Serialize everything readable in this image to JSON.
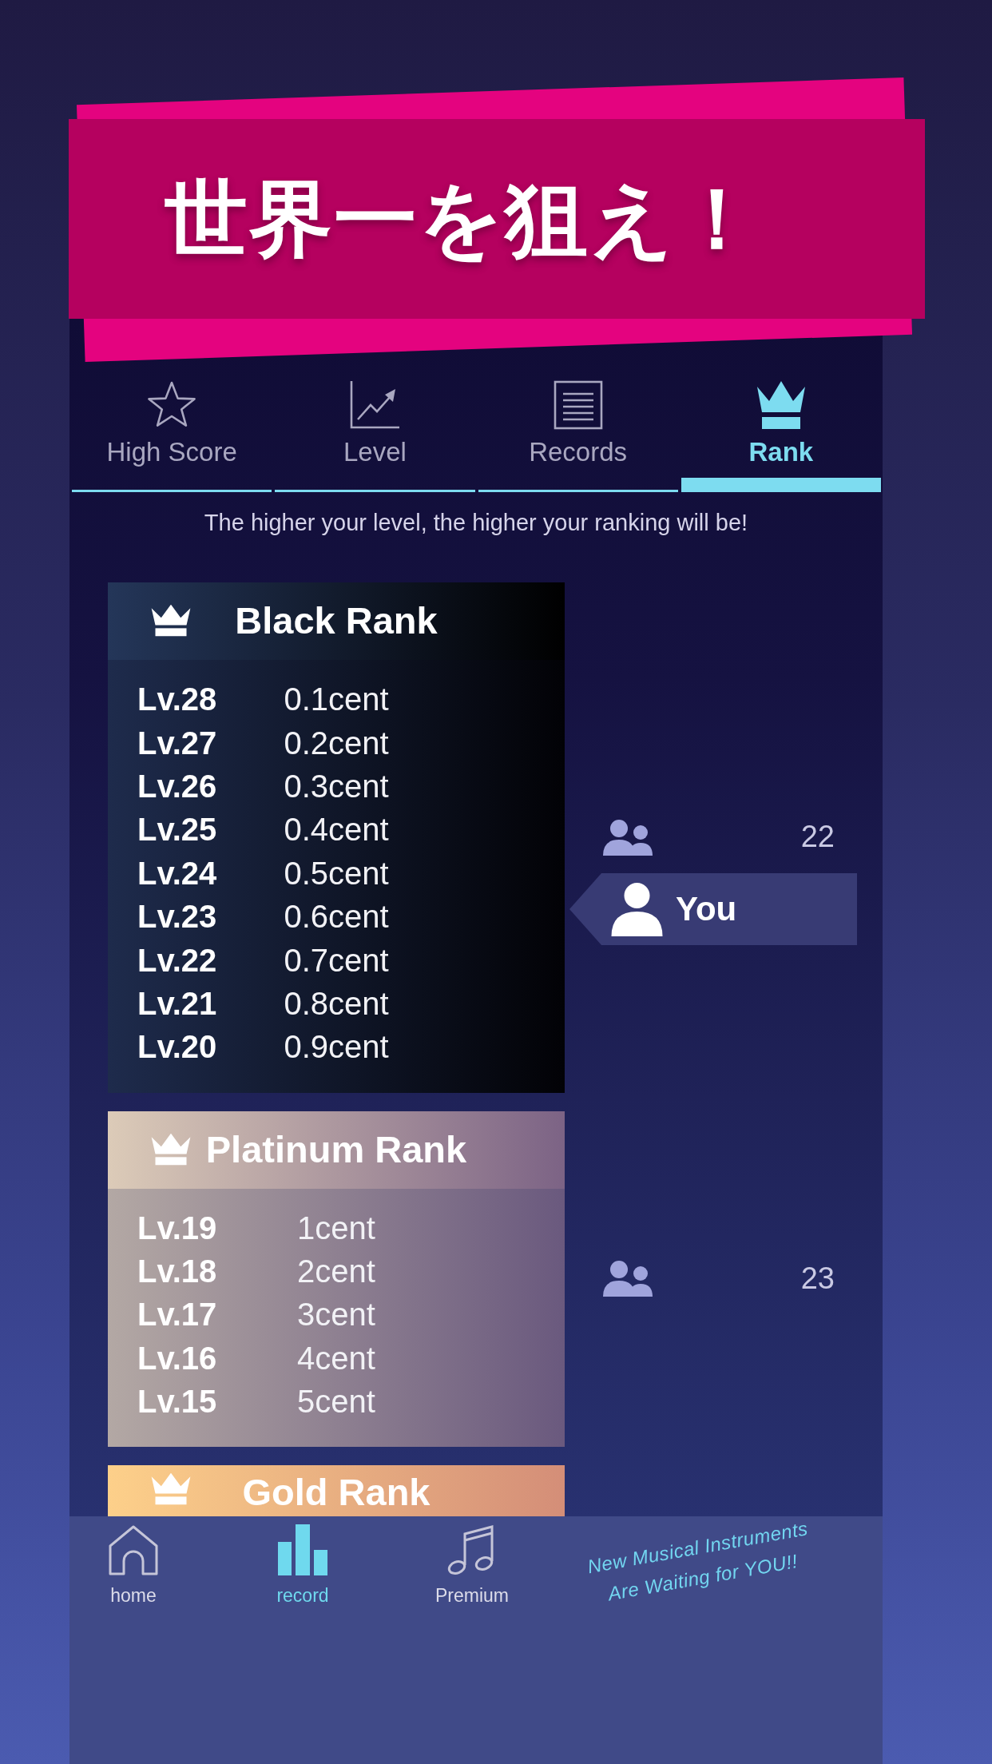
{
  "banner": {
    "title": "世界一を狙え！"
  },
  "tabs": [
    {
      "label": "High Score",
      "selected": false
    },
    {
      "label": "Level",
      "selected": false
    },
    {
      "label": "Records",
      "selected": false
    },
    {
      "label": "Rank",
      "selected": true
    }
  ],
  "hint": "The higher your level, the higher your ranking will be!",
  "ranks": [
    {
      "kind": "black",
      "title": "Black Rank",
      "levels": [
        {
          "level": "Lv.28",
          "reward": "0.1cent"
        },
        {
          "level": "Lv.27",
          "reward": "0.2cent"
        },
        {
          "level": "Lv.26",
          "reward": "0.3cent"
        },
        {
          "level": "Lv.25",
          "reward": "0.4cent"
        },
        {
          "level": "Lv.24",
          "reward": "0.5cent"
        },
        {
          "level": "Lv.23",
          "reward": "0.6cent"
        },
        {
          "level": "Lv.22",
          "reward": "0.7cent"
        },
        {
          "level": "Lv.21",
          "reward": "0.8cent"
        },
        {
          "level": "Lv.20",
          "reward": "0.9cent"
        }
      ],
      "players": "22",
      "you_label": "You"
    },
    {
      "kind": "platinum",
      "title": "Platinum Rank",
      "levels": [
        {
          "level": "Lv.19",
          "reward": "1cent"
        },
        {
          "level": "Lv.18",
          "reward": "2cent"
        },
        {
          "level": "Lv.17",
          "reward": "3cent"
        },
        {
          "level": "Lv.16",
          "reward": "4cent"
        },
        {
          "level": "Lv.15",
          "reward": "5cent"
        }
      ],
      "players": "23"
    },
    {
      "kind": "gold",
      "title": "Gold Rank"
    }
  ],
  "nav": [
    {
      "label": "home",
      "selected": false
    },
    {
      "label": "record",
      "selected": true
    },
    {
      "label": "Premium",
      "selected": false
    }
  ],
  "promo": [
    "New Musical Instruments",
    "Are Waiting for YOU!!"
  ]
}
